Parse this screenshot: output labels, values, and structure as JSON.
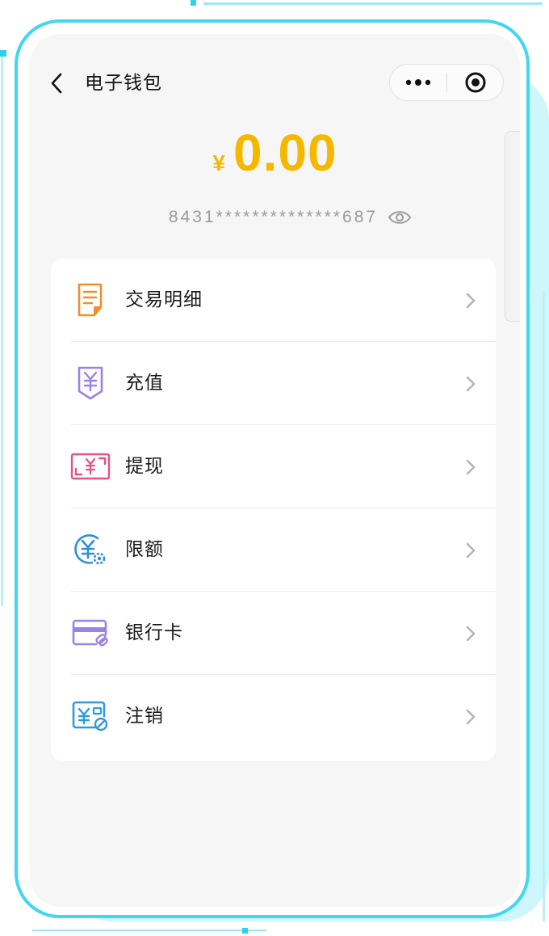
{
  "header": {
    "title": "电子钱包"
  },
  "wallet": {
    "currency_symbol": "¥",
    "balance": "0.00",
    "card_number_masked": "8431**************687"
  },
  "menu": {
    "items": [
      {
        "label": "交易明细",
        "icon": "receipt-icon",
        "color": "#f0902c"
      },
      {
        "label": "充值",
        "icon": "recharge-icon",
        "color": "#9a82e6"
      },
      {
        "label": "提现",
        "icon": "withdraw-icon",
        "color": "#ea4f86"
      },
      {
        "label": "限额",
        "icon": "limit-icon",
        "color": "#2f8fd8"
      },
      {
        "label": "银行卡",
        "icon": "bank-card-icon",
        "color": "#9a82e6"
      },
      {
        "label": "注销",
        "icon": "cancel-account-icon",
        "color": "#2f9adc"
      }
    ]
  },
  "colors": {
    "accent": "#f5b800",
    "frame": "#42d6f0",
    "background": "#f6f6f6"
  }
}
